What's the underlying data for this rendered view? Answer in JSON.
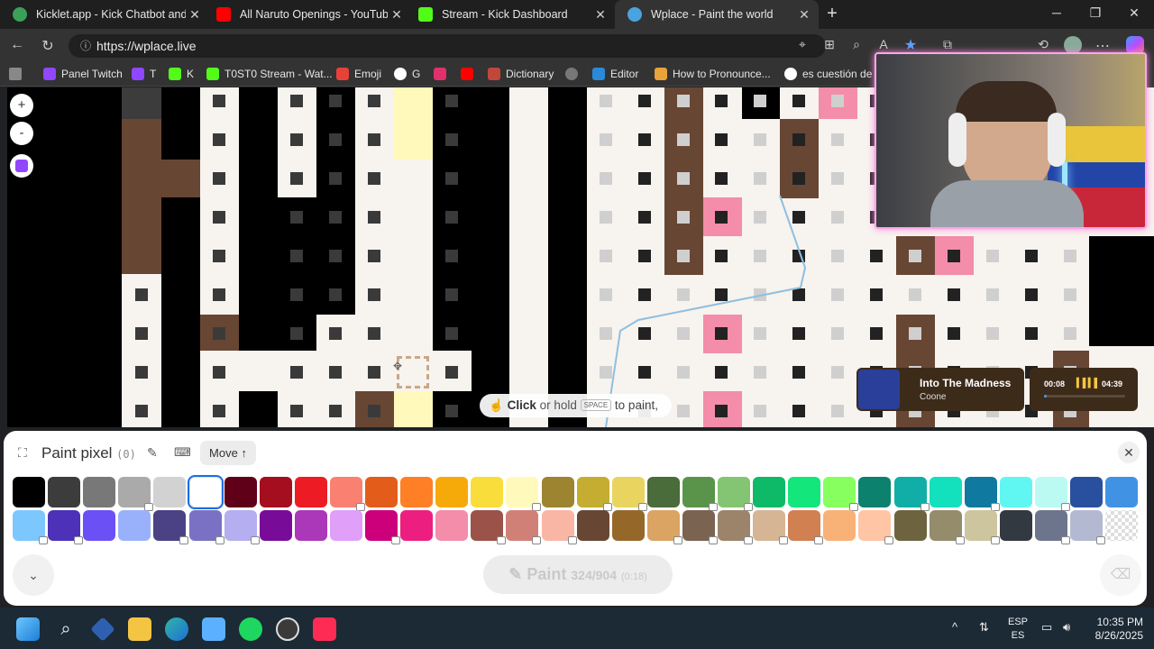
{
  "browser": {
    "tabs": [
      {
        "title": "Kicklet.app - Kick Chatbot and Ov",
        "icon": "kicklet-icon",
        "color": "#3aa05a"
      },
      {
        "title": "All Naruto Openings - YouTube",
        "icon": "youtube-icon",
        "color": "#ff0000"
      },
      {
        "title": "Stream - Kick Dashboard",
        "icon": "kick-icon",
        "color": "#53fc18"
      },
      {
        "title": "Wplace - Paint the world",
        "icon": "wplace-icon",
        "color": "#4aa3df"
      }
    ],
    "active_tab": 3,
    "new_tab": "+",
    "url": "https://wplace.live",
    "bookmarks": [
      {
        "label": "Panel Twitch",
        "color": "#9146ff"
      },
      {
        "label": "T",
        "color": "#9146ff"
      },
      {
        "label": "K",
        "color": "#53fc18"
      },
      {
        "label": "T0ST0 Stream - Wat...",
        "color": "#53fc18"
      },
      {
        "label": "Emoji",
        "color": "#e8413a"
      },
      {
        "label": "G",
        "color": "#ffffff"
      },
      {
        "label": "",
        "color": "#e1306c"
      },
      {
        "label": "",
        "color": "#ff0000"
      },
      {
        "label": "Dictionary",
        "color": "#c2473a"
      },
      {
        "label": "",
        "color": "#777777"
      },
      {
        "label": "Editor",
        "color": "#2a89d8"
      },
      {
        "label": "How to Pronounce...",
        "color": "#e8a33a"
      },
      {
        "label": "es cuestión de ti",
        "color": "#ffffff"
      }
    ]
  },
  "map": {
    "zoom_in": "+",
    "zoom_out": "-",
    "hint_click": "Click",
    "hint_mid": " or hold ",
    "hint_key": "SPACE",
    "hint_end": " to paint,"
  },
  "music": {
    "title": "Into The Madness",
    "artist": "Coone",
    "elapsed": "00:08",
    "duration": "04:39",
    "progress": 0.03
  },
  "panel": {
    "title": "Paint pixel",
    "count": "(0)",
    "move_label": "Move",
    "paint_label": "Paint",
    "charges": "324/904",
    "cooldown": "(0:18)",
    "colors_row1": [
      {
        "hex": "#000000",
        "locked": false
      },
      {
        "hex": "#3c3c3c",
        "locked": false
      },
      {
        "hex": "#787878",
        "locked": false
      },
      {
        "hex": "#aaaaaa",
        "locked": true
      },
      {
        "hex": "#d2d2d2",
        "locked": false
      },
      {
        "hex": "#ffffff",
        "locked": false,
        "selected": true
      },
      {
        "hex": "#600018",
        "locked": false
      },
      {
        "hex": "#a50e1e",
        "locked": false
      },
      {
        "hex": "#ed1c24",
        "locked": false
      },
      {
        "hex": "#fa8072",
        "locked": true
      },
      {
        "hex": "#e45c1a",
        "locked": false
      },
      {
        "hex": "#ff7f27",
        "locked": false
      },
      {
        "hex": "#f6aa09",
        "locked": false
      },
      {
        "hex": "#f9dd3b",
        "locked": false
      },
      {
        "hex": "#fffabc",
        "locked": true
      },
      {
        "hex": "#9c8431",
        "locked": false
      },
      {
        "hex": "#c5ad31",
        "locked": true
      },
      {
        "hex": "#e8d45f",
        "locked": true
      },
      {
        "hex": "#4a6b3a",
        "locked": false
      },
      {
        "hex": "#5a944a",
        "locked": true
      },
      {
        "hex": "#84c573",
        "locked": true
      },
      {
        "hex": "#0eb968",
        "locked": false
      },
      {
        "hex": "#13e67b",
        "locked": false
      },
      {
        "hex": "#87ff5e",
        "locked": true
      },
      {
        "hex": "#0c816e",
        "locked": false
      },
      {
        "hex": "#10aea6",
        "locked": true
      },
      {
        "hex": "#13e1be",
        "locked": false
      },
      {
        "hex": "#0f799f",
        "locked": true
      },
      {
        "hex": "#60f7f2",
        "locked": false
      },
      {
        "hex": "#bbfaf2",
        "locked": true
      },
      {
        "hex": "#28509e",
        "locked": false
      },
      {
        "hex": "#4093e4",
        "locked": false
      }
    ],
    "colors_row2": [
      {
        "hex": "#7dc7ff",
        "locked": true
      },
      {
        "hex": "#4d31b8",
        "locked": true
      },
      {
        "hex": "#6b50f6",
        "locked": false
      },
      {
        "hex": "#99b1fb",
        "locked": false
      },
      {
        "hex": "#4a4284",
        "locked": true
      },
      {
        "hex": "#7a71c4",
        "locked": true
      },
      {
        "hex": "#b5aef1",
        "locked": true
      },
      {
        "hex": "#780c99",
        "locked": false
      },
      {
        "hex": "#aa38b9",
        "locked": false
      },
      {
        "hex": "#e09ff9",
        "locked": false
      },
      {
        "hex": "#cb007a",
        "locked": true
      },
      {
        "hex": "#ec1f80",
        "locked": false
      },
      {
        "hex": "#f38da9",
        "locked": false
      },
      {
        "hex": "#9b5249",
        "locked": true
      },
      {
        "hex": "#d18078",
        "locked": true
      },
      {
        "hex": "#fab6a4",
        "locked": true
      },
      {
        "hex": "#684634",
        "locked": false
      },
      {
        "hex": "#95682a",
        "locked": false
      },
      {
        "hex": "#dba463",
        "locked": true
      },
      {
        "hex": "#7b6352",
        "locked": true
      },
      {
        "hex": "#9c846b",
        "locked": true
      },
      {
        "hex": "#d6b594",
        "locked": true
      },
      {
        "hex": "#d18051",
        "locked": true
      },
      {
        "hex": "#f8b277",
        "locked": false
      },
      {
        "hex": "#ffc5a5",
        "locked": true
      },
      {
        "hex": "#6d643f",
        "locked": false
      },
      {
        "hex": "#948c6b",
        "locked": true
      },
      {
        "hex": "#cdc59e",
        "locked": true
      },
      {
        "hex": "#333941",
        "locked": false
      },
      {
        "hex": "#6d758d",
        "locked": true
      },
      {
        "hex": "#b3b9d1",
        "locked": true
      },
      {
        "hex": "transparent",
        "locked": false
      }
    ]
  },
  "taskbar": {
    "apps": [
      {
        "name": "start-icon",
        "color": "#3a9cf0"
      },
      {
        "name": "search-icon",
        "color": "#e0e0e0"
      },
      {
        "name": "app-diamond-icon",
        "color": "#6fa8ff"
      },
      {
        "name": "file-explorer-icon",
        "color": "#f4c542"
      },
      {
        "name": "edge-icon",
        "color": "#2fb5a6"
      },
      {
        "name": "notepad-icon",
        "color": "#5bb0ff"
      },
      {
        "name": "spotify-icon",
        "color": "#1ed760"
      },
      {
        "name": "obs-icon",
        "color": "#555555"
      },
      {
        "name": "tiktok-icon",
        "color": "#fe2c55"
      }
    ],
    "lang_top": "ESP",
    "lang_bottom": "ES",
    "time": "10:35 PM",
    "date": "8/26/2025"
  }
}
